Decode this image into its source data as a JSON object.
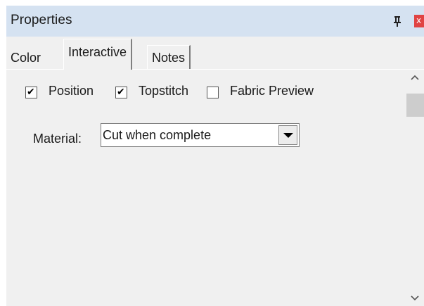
{
  "window": {
    "title": "Properties",
    "pin_icon": "pin-icon",
    "close_label": "x",
    "close_color": "#e04343"
  },
  "tabs": [
    {
      "label": "Color",
      "active": false
    },
    {
      "label": "Interactive",
      "active": true
    },
    {
      "label": "Notes",
      "active": false
    }
  ],
  "options": [
    {
      "label": "Position",
      "checked": true
    },
    {
      "label": "Topstitch",
      "checked": true
    },
    {
      "label": "Fabric Preview",
      "checked": false
    }
  ],
  "material": {
    "label": "Material:",
    "value": "Cut when complete"
  },
  "scrollbar": {
    "up_icon": "chevron-up-icon",
    "down_icon": "chevron-down-icon"
  },
  "colors": {
    "titlebar": "#d5e2f1",
    "panel": "#f0f0f0"
  }
}
